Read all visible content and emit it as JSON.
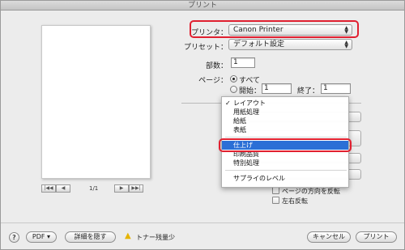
{
  "window": {
    "title": "プリント"
  },
  "printer": {
    "label": "プリンタ：",
    "value": "Canon Printer"
  },
  "preset": {
    "label": "プリセット：",
    "value": "デフォルト設定"
  },
  "copies": {
    "label": "部数：",
    "value": "1"
  },
  "pages": {
    "label": "ページ：",
    "all_label": "すべて",
    "from_label": "開始：",
    "from_value": "1",
    "to_label": "終了：",
    "to_value": "1"
  },
  "pager": {
    "first": "|◀◀",
    "prev": "◀",
    "text": "1/1",
    "next": "▶",
    "last": "▶▶|"
  },
  "panel_menu": {
    "items": [
      {
        "label": "レイアウト",
        "checked": true
      },
      {
        "label": "用紙処理",
        "checked": false
      },
      {
        "label": "給紙",
        "checked": false
      },
      {
        "label": "表紙",
        "checked": false
      },
      {
        "label": "仕上げ",
        "selected": true
      },
      {
        "label": "印刷品質",
        "checked": false
      },
      {
        "label": "特別処理",
        "checked": false
      },
      {
        "label": "サプライのレベル",
        "checked": false
      }
    ]
  },
  "layout_options": {
    "reverse_page_orientation": "ページの方向を反転",
    "flip_horizontal": "左右反転"
  },
  "footer": {
    "help": "?",
    "pdf": "PDF ▾",
    "details": "詳細を隠す",
    "warning_text": "トナー残量少",
    "cancel": "キャンセル",
    "print": "プリント"
  },
  "colors": {
    "highlight": "#e02030",
    "menu_selection": "#2b6fd6",
    "warning": "#e6b400"
  }
}
